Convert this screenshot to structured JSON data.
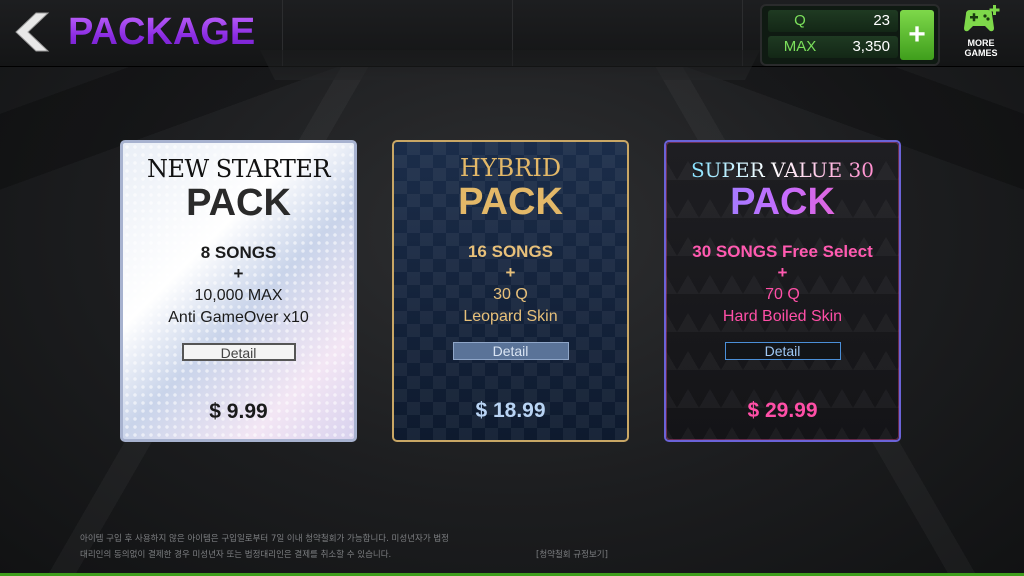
{
  "header": {
    "title": "PACKAGE",
    "back_icon": "chevron-left-icon",
    "currency": {
      "q_label": "Q",
      "q_value": "23",
      "max_label": "MAX",
      "max_value": "3,350",
      "plus_label": "+"
    },
    "more_games_label": "MORE GAMES",
    "more_games_icon": "gamepad-plus-icon"
  },
  "packages": [
    {
      "title_top": "NEW STARTER",
      "title_main": "PACK",
      "lines": [
        "8 SONGS",
        "+",
        "10,000  MAX",
        "Anti GameOver  x10"
      ],
      "detail_label": "Detail",
      "price": "$ 9.99"
    },
    {
      "title_top": "HYBRID",
      "title_main": "PACK",
      "lines": [
        "16 SONGS",
        "+",
        "30 Q",
        "Leopard Skin"
      ],
      "detail_label": "Detail",
      "price": "$ 18.99"
    },
    {
      "title_top": "SUPER VALUE 30",
      "title_main": "PACK",
      "lines": [
        "30 SONGS Free Select",
        "+",
        "70 Q",
        "Hard Boiled Skin"
      ],
      "detail_label": "Detail",
      "price": "$ 29.99"
    }
  ],
  "footer": {
    "disclaimer_1": "아이템 구입 후 사용하지 않은 아이템은 구입일로부터 7일 이내 청약철회가 가능합니다. 미성년자가 법정",
    "disclaimer_2": "대리인의 동의없이 결제한 경우 미성년자 또는 법정대리인은 결제를 취소할 수 있습니다.",
    "policy_link": "[청약철회 규정보기]"
  },
  "colors": {
    "title_purple": "#9b3ef0",
    "gold": "#e3b868",
    "pink": "#ff4fa7",
    "green": "#3f9e1c"
  }
}
